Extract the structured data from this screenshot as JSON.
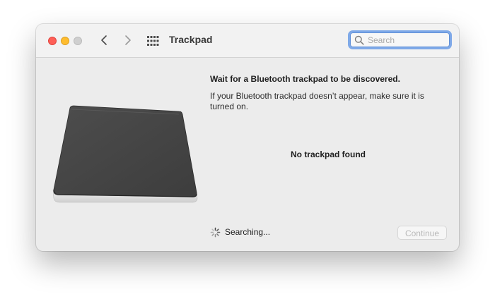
{
  "window": {
    "title": "Trackpad",
    "colors": {
      "close": "#fe5f57",
      "minimize": "#febc2e",
      "zoom_disabled": "#cfcfcf",
      "search_focus_ring": "#7fa9e8"
    }
  },
  "toolbar": {
    "back_icon": "chevron-left-icon",
    "forward_icon": "chevron-right-icon",
    "grid_icon": "show-all-grid-icon",
    "search": {
      "placeholder": "Search",
      "value": ""
    }
  },
  "content": {
    "illustration": "magic-trackpad-illustration",
    "heading": "Wait for a Bluetooth trackpad to be discovered.",
    "description": "If your Bluetooth trackpad doesn’t appear, make sure it is turned on.",
    "status": "No trackpad found"
  },
  "footer": {
    "spinner_icon": "spinner-icon",
    "searching_label": "Searching...",
    "continue_label": "Continue",
    "continue_enabled": false
  }
}
